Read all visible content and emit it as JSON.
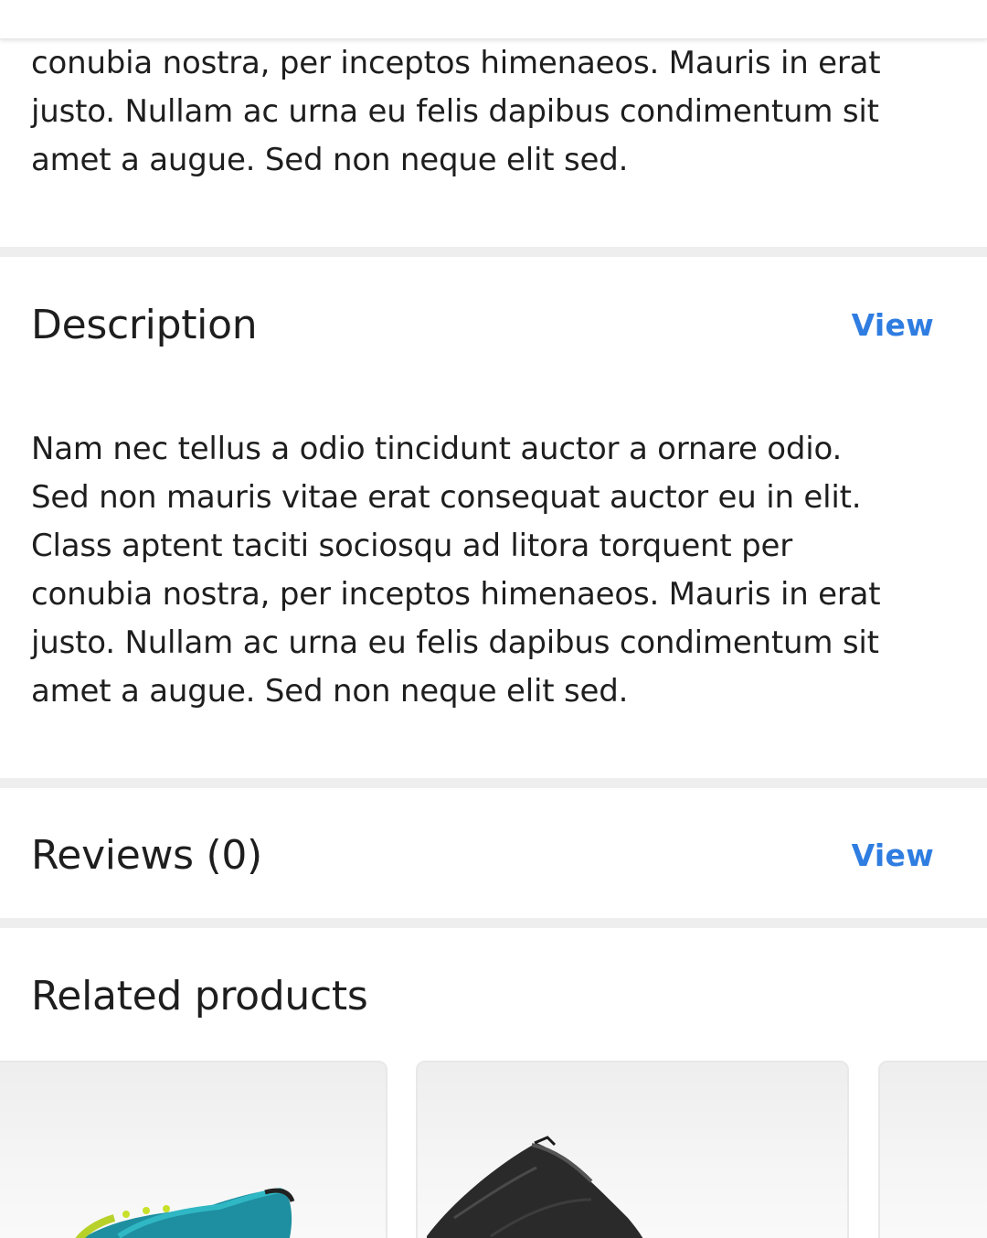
{
  "previous_section": {
    "text_lines": "conubia nostra, per inceptos himenaeos. Mauris in erat\njusto. Nullam ac urna eu felis dapibus condimentum sit\namet a augue. Sed non neque elit sed."
  },
  "description": {
    "title": "Description",
    "view_label": "View",
    "text": "Nam nec tellus a odio tincidunt auctor a ornare odio.\nSed non mauris vitae erat consequat auctor eu in elit.\nClass aptent taciti sociosqu ad litora torquent per\nconubia nostra, per inceptos himenaeos. Mauris in erat\njusto. Nullam ac urna eu felis dapibus condimentum sit\namet a augue. Sed non neque elit sed."
  },
  "reviews": {
    "title": "Reviews (0)",
    "view_label": "View"
  },
  "related": {
    "title": "Related products",
    "products": [
      {
        "icon": "sneaker-image"
      },
      {
        "icon": "jeans-image"
      },
      {
        "icon": "product-image"
      }
    ]
  },
  "colors": {
    "link": "#2f7de1",
    "divider": "#eeeeee",
    "text": "#1e1e1e"
  }
}
